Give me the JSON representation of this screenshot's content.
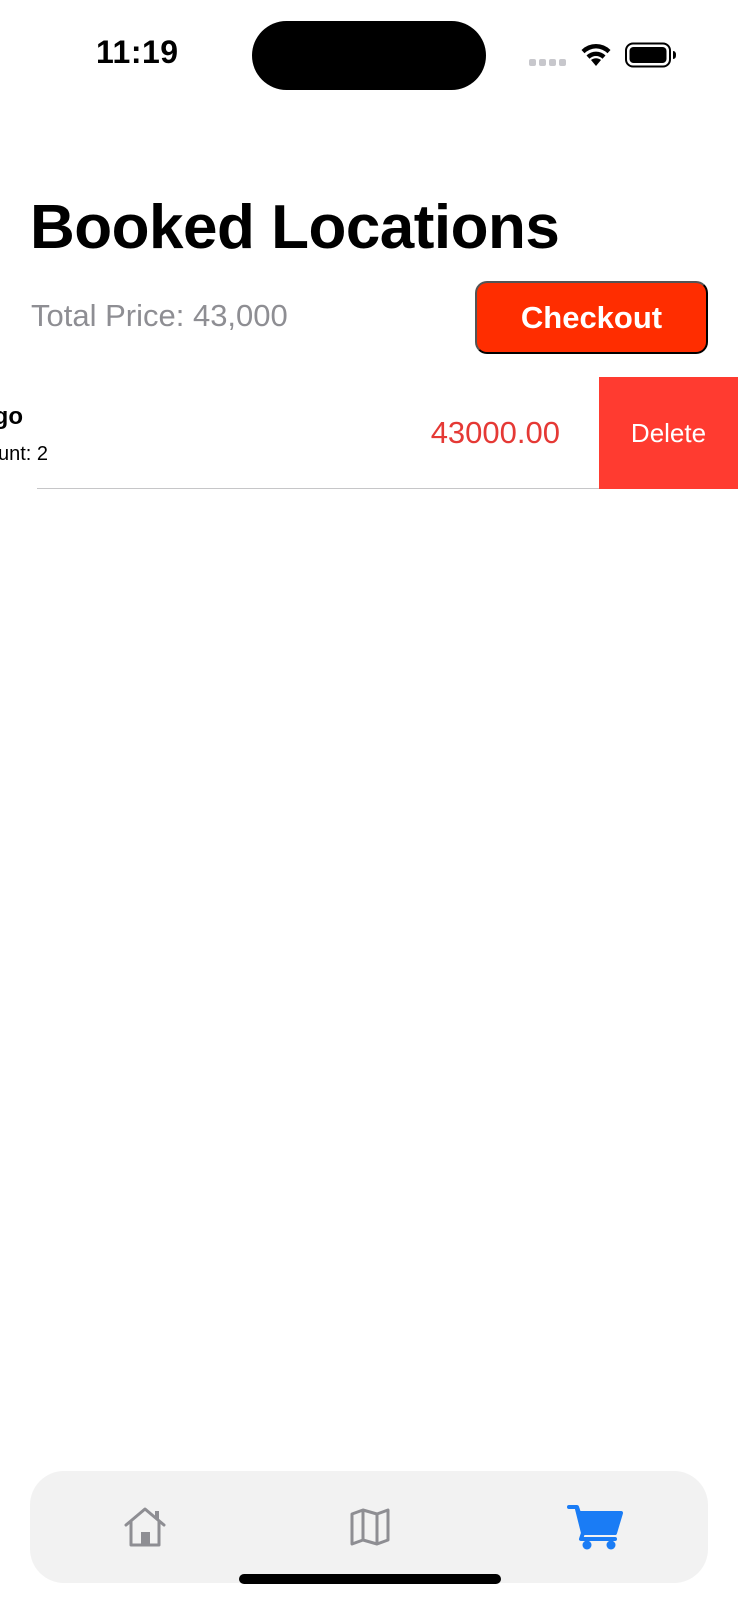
{
  "status_bar": {
    "time": "11:19"
  },
  "header": {
    "title": "Booked Locations",
    "total_price": "Total Price: 43,000",
    "checkout_label": "Checkout"
  },
  "booked_items": [
    {
      "name_visible": "go",
      "count_visible": "unt: 2",
      "price": "43000.00",
      "delete_label": "Delete"
    }
  ],
  "tabs": [
    {
      "icon": "home-icon",
      "selected": false
    },
    {
      "icon": "map-icon",
      "selected": false
    },
    {
      "icon": "cart-icon",
      "selected": true
    }
  ],
  "colors": {
    "checkout": "#ff2d00",
    "delete": "#ff3b30",
    "price": "#e53935",
    "tab_active": "#1a7cf5",
    "tab_inactive": "#8e8e93"
  }
}
